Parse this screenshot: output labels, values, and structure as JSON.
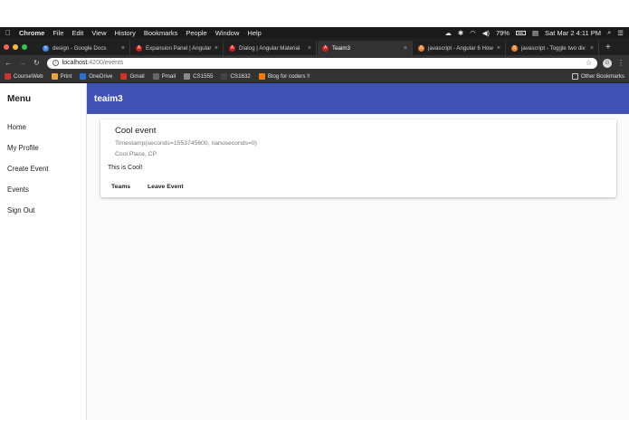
{
  "menubar": {
    "app": "Chrome",
    "items": [
      "File",
      "Edit",
      "View",
      "History",
      "Bookmarks",
      "People",
      "Window",
      "Help"
    ],
    "battery": "79%",
    "clock": "Sat Mar 2  4:11 PM"
  },
  "tabs": [
    {
      "title": "design - Google Docs",
      "color": "#4285f4",
      "glyph": "≡"
    },
    {
      "title": "Expansion Panel | Angular",
      "color": "#dd1b16",
      "glyph": "A"
    },
    {
      "title": "Dialog | Angular Material",
      "color": "#dd1b16",
      "glyph": "A"
    },
    {
      "title": "Teaim3",
      "color": "#dd1b16",
      "glyph": "A",
      "active": true
    },
    {
      "title": "javascript - Angular 6 How",
      "color": "#f48024",
      "glyph": "S"
    },
    {
      "title": "javascript - Toggle two div",
      "color": "#f48024",
      "glyph": "S"
    }
  ],
  "address": {
    "host": "localhost",
    "path": ":4200/events",
    "profile": "G"
  },
  "bookmarks": [
    {
      "label": "CourseWeb",
      "color": "#cc3333"
    },
    {
      "label": "Print",
      "color": "#e8a33d"
    },
    {
      "label": "OneDrive",
      "color": "#2a6fd6"
    },
    {
      "label": "Gmail",
      "color": "#d93025"
    },
    {
      "label": "Pmail",
      "color": "#666666"
    },
    {
      "label": "CS1555",
      "color": "#888888"
    },
    {
      "label": "CS1632",
      "color": "#444444"
    },
    {
      "label": "Blog for coders !!",
      "color": "#f57c00"
    }
  ],
  "other_bookmarks": "Other Bookmarks",
  "sidenav": {
    "title": "Menu",
    "items": [
      "Home",
      "My Profile",
      "Create Event",
      "Events",
      "Sign Out"
    ]
  },
  "toolbar": {
    "title": "teaim3",
    "color": "#3f51b5"
  },
  "event": {
    "title": "Cool event",
    "timestamp": "Timestamp(seconds=1553745600, nanoseconds=0)",
    "location": "Cool Place, CP",
    "description": "This is Cool!",
    "actions": [
      "Teams",
      "Leave Event"
    ]
  }
}
